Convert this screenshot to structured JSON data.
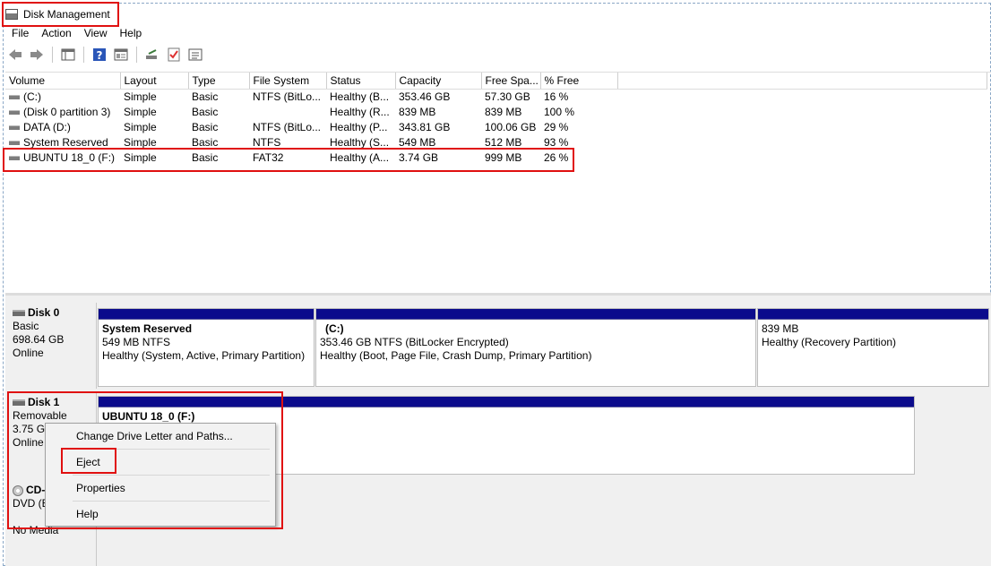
{
  "window": {
    "title": "Disk Management"
  },
  "menubar": {
    "items": [
      "File",
      "Action",
      "View",
      "Help"
    ]
  },
  "toolbar": {
    "icons": [
      "back-arrow-icon",
      "forward-arrow-icon",
      "console-tree-icon",
      "help-icon",
      "properties-icon",
      "rescan-disks-icon",
      "checklist-icon",
      "settings-list-icon"
    ]
  },
  "volume_list": {
    "columns": [
      "Volume",
      "Layout",
      "Type",
      "File System",
      "Status",
      "Capacity",
      "Free Spa...",
      "% Free"
    ],
    "rows": [
      {
        "volume": "(C:)",
        "layout": "Simple",
        "type": "Basic",
        "file_system": "NTFS (BitLo...",
        "status": "Healthy (B...",
        "capacity": "353.46 GB",
        "free": "57.30 GB",
        "pct_free": "16 %"
      },
      {
        "volume": "(Disk 0 partition 3)",
        "layout": "Simple",
        "type": "Basic",
        "file_system": "",
        "status": "Healthy (R...",
        "capacity": "839 MB",
        "free": "839 MB",
        "pct_free": "100 %"
      },
      {
        "volume": "DATA (D:)",
        "layout": "Simple",
        "type": "Basic",
        "file_system": "NTFS (BitLo...",
        "status": "Healthy (P...",
        "capacity": "343.81 GB",
        "free": "100.06 GB",
        "pct_free": "29 %"
      },
      {
        "volume": "System Reserved",
        "layout": "Simple",
        "type": "Basic",
        "file_system": "NTFS",
        "status": "Healthy (S...",
        "capacity": "549 MB",
        "free": "512 MB",
        "pct_free": "93 %"
      },
      {
        "volume": "UBUNTU 18_0 (F:)",
        "layout": "Simple",
        "type": "Basic",
        "file_system": "FAT32",
        "status": "Healthy (A...",
        "capacity": "3.74 GB",
        "free": "999 MB",
        "pct_free": "26 %"
      }
    ]
  },
  "disks": {
    "disk0": {
      "name": "Disk 0",
      "type": "Basic",
      "size": "698.64 GB",
      "state": "Online",
      "partitions": [
        {
          "name": "System Reserved",
          "detail": "549 MB NTFS",
          "status": "Healthy (System, Active, Primary Partition)"
        },
        {
          "name": "(C:)",
          "detail": "353.46 GB NTFS (BitLocker Encrypted)",
          "status": "Healthy (Boot, Page File, Crash Dump, Primary Partition)"
        },
        {
          "name": "",
          "detail": "839 MB",
          "status": "Healthy (Recovery Partition)"
        }
      ]
    },
    "disk1": {
      "name": "Disk 1",
      "type": "Removable",
      "size": "3.75 GB",
      "state": "Online",
      "partitions": [
        {
          "name": "UBUNTU 18_0  (F:)"
        }
      ]
    },
    "cdrom": {
      "name": "CD-",
      "type": "DVD (E",
      "state": "No Media"
    }
  },
  "context_menu": {
    "items": [
      "Change Drive Letter and Paths...",
      "Eject",
      "Properties",
      "Help"
    ]
  },
  "colors": {
    "partition_bar": "#0b0b8c",
    "highlight": "#e01010"
  }
}
